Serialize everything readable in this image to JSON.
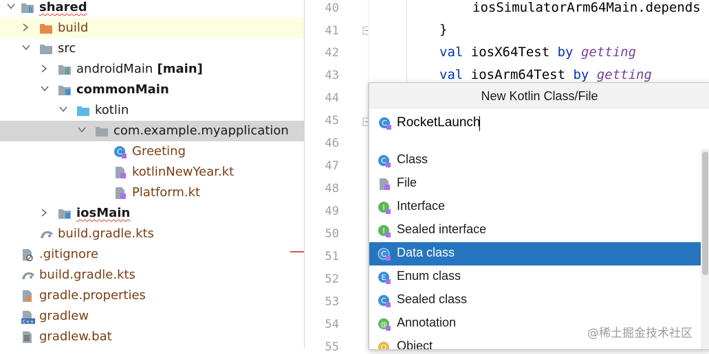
{
  "project_tree": {
    "items": [
      {
        "label": "shared",
        "suffix": "",
        "icon": "module-folder-icon"
      },
      {
        "label": "build",
        "suffix": "",
        "icon": "build-folder-icon"
      },
      {
        "label": "src",
        "suffix": "",
        "icon": "folder-icon"
      },
      {
        "label": "androidMain",
        "suffix": " [main]",
        "icon": "source-set-folder-icon"
      },
      {
        "label": "commonMain",
        "suffix": "",
        "icon": "source-set-folder-icon"
      },
      {
        "label": "kotlin",
        "suffix": "",
        "icon": "source-root-folder-icon"
      },
      {
        "label": "com.example.myapplication",
        "suffix": "",
        "icon": "package-folder-icon"
      },
      {
        "label": "Greeting",
        "suffix": "",
        "icon": "kotlin-class-icon"
      },
      {
        "label": "kotlinNewYear.kt",
        "suffix": "",
        "icon": "kotlin-file-icon"
      },
      {
        "label": "Platform.kt",
        "suffix": "",
        "icon": "kotlin-file-icon"
      },
      {
        "label": "iosMain",
        "suffix": "",
        "icon": "source-set-folder-icon"
      },
      {
        "label": "build.gradle.kts",
        "suffix": "",
        "icon": "gradle-icon"
      },
      {
        "label": ".gitignore",
        "suffix": "",
        "icon": "ignore-file-icon"
      },
      {
        "label": "build.gradle.kts",
        "suffix": "",
        "icon": "gradle-icon"
      },
      {
        "label": "gradle.properties",
        "suffix": "",
        "icon": "properties-file-icon"
      },
      {
        "label": "gradlew",
        "suffix": "",
        "icon": "cpp-file-icon"
      },
      {
        "label": "gradlew.bat",
        "suffix": "",
        "icon": "text-file-icon"
      }
    ]
  },
  "editor": {
    "line_numbers": [
      "40",
      "41",
      "42",
      "43",
      "44",
      "45",
      "46",
      "47",
      "48",
      "49",
      "50",
      "51",
      "52",
      "53",
      "54",
      "55"
    ],
    "lines": [
      {
        "text": "iosSimulatorArm64Main.depends"
      },
      {
        "text": "}"
      },
      {
        "kw": "val",
        "name": " iosX64Test ",
        "by": "by",
        "getter": " getting"
      },
      {
        "kw": "val",
        "name": " iosArm64Test ",
        "by": "by",
        "getter": " getting"
      }
    ]
  },
  "popup": {
    "title": "New Kotlin Class/File",
    "input_value": "RocketLaunch",
    "options": [
      {
        "label": "Class",
        "icon": "class-icon"
      },
      {
        "label": "File",
        "icon": "file-icon"
      },
      {
        "label": "Interface",
        "icon": "interface-icon"
      },
      {
        "label": "Sealed interface",
        "icon": "sealed-interface-icon"
      },
      {
        "label": "Data class",
        "icon": "data-class-icon"
      },
      {
        "label": "Enum class",
        "icon": "enum-class-icon"
      },
      {
        "label": "Sealed class",
        "icon": "sealed-class-icon"
      },
      {
        "label": "Annotation",
        "icon": "annotation-icon"
      },
      {
        "label": "Object",
        "icon": "object-icon"
      }
    ],
    "selected": "Data class"
  },
  "watermark": "@稀土掘金技术社区",
  "colors": {
    "selection_blue": "#2675bf",
    "keyword": "#0033b3",
    "italic_getter": "#7a3e9d",
    "file_brown": "#7a3e14",
    "kotlin_class": "#3d8fd6"
  }
}
